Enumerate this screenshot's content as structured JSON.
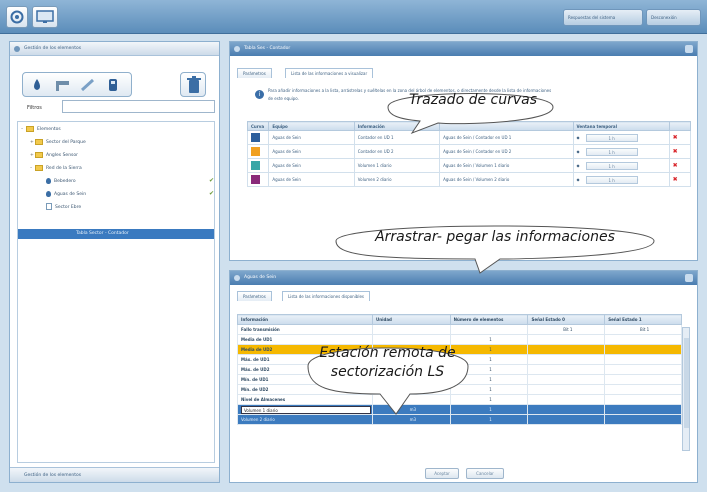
{
  "topbar": {
    "right_buttons": [
      "Respuestas del sistema",
      "Desconexión"
    ]
  },
  "left_panel": {
    "header": "Gestión de los elementos",
    "filter_label": "Filtros",
    "filter_value": "",
    "tree": [
      {
        "label": "Elementos",
        "kind": "folder",
        "level": 0,
        "expanded": true
      },
      {
        "label": "Sector del Parque",
        "kind": "folder",
        "level": 1,
        "expanded": false
      },
      {
        "label": "Angles Sensor",
        "kind": "folder",
        "level": 1,
        "expanded": false
      },
      {
        "label": "Red de la Sierra",
        "kind": "folder",
        "level": 1,
        "expanded": true
      },
      {
        "label": "Bebedero",
        "kind": "drop",
        "level": 2,
        "checked": true
      },
      {
        "label": "Aguas de Sein",
        "kind": "drop",
        "level": 2,
        "checked": true
      },
      {
        "label": "Sector Ebre",
        "kind": "page",
        "level": 2,
        "checked": false
      }
    ],
    "selected_item": "Tabla Sector - Contador",
    "footer": "Gestión de los elementos"
  },
  "top_right_panel": {
    "header": "Tabla Ses - Contador",
    "tabs": [
      "Parámetros",
      "Lista de las informaciones a visualizar"
    ],
    "info_lines": [
      "Para añadir informaciones a la lista, arrástrelas y suéltelas en la zona del árbol de elementos, o directamente desde la lista de informaciones",
      "de este equipo."
    ],
    "columns": [
      "Curva",
      "Equipo",
      "Información",
      "",
      "Ventana temporal",
      ""
    ],
    "rows": [
      {
        "color": "#2b5e9c",
        "equipo": "Aguas de Sein",
        "info": "Contador en UD 1",
        "full": "Aguas de Sein / Contador en UD 1",
        "window": "1 h"
      },
      {
        "color": "#f0a020",
        "equipo": "Aguas de Sein",
        "info": "Contador en UD 2",
        "full": "Aguas de Sein / Contador en UD 2",
        "window": "1 h"
      },
      {
        "color": "#3aa6a6",
        "equipo": "Aguas de Sein",
        "info": "Volumen 1 diario",
        "full": "Aguas de Sein / Volumen 1 diario",
        "window": "1 h"
      },
      {
        "color": "#8a2a7a",
        "equipo": "Aguas de Sein",
        "info": "Volumen 2 diario",
        "full": "Aguas de Sein / Volumen 2 diario",
        "window": "1 h"
      }
    ]
  },
  "bottom_right_panel": {
    "header": "Aguas de Sein",
    "tabs": [
      "Parámetros",
      "Lista de las informaciones disponibles"
    ],
    "columns": [
      "Información",
      "Unidad",
      "Número de elementos",
      "Señal Estado 0",
      "Señal Estado 1"
    ],
    "rows": [
      {
        "name": "Fallo transmisión",
        "unit": "",
        "count": "",
        "s0": "Bit 1",
        "s1": "Bit 1",
        "style": "normal"
      },
      {
        "name": "Media de UD1",
        "unit": "",
        "count": "1",
        "s0": "",
        "s1": "",
        "style": "normal"
      },
      {
        "name": "Media de UD2",
        "unit": "",
        "count": "1",
        "s0": "",
        "s1": "",
        "style": "highlight"
      },
      {
        "name": "Máx. de UD1",
        "unit": "",
        "count": "1",
        "s0": "",
        "s1": "",
        "style": "normal"
      },
      {
        "name": "Máx. de UD2",
        "unit": "",
        "count": "1",
        "s0": "",
        "s1": "",
        "style": "normal"
      },
      {
        "name": "Mín. de UD1",
        "unit": "",
        "count": "1",
        "s0": "",
        "s1": "",
        "style": "normal"
      },
      {
        "name": "Mín. de UD2",
        "unit": "",
        "count": "1",
        "s0": "",
        "s1": "",
        "style": "normal"
      },
      {
        "name": "Nivel de Almacenes",
        "unit": "",
        "count": "1",
        "s0": "",
        "s1": "",
        "style": "normal"
      },
      {
        "name": "Volumen 1 diario",
        "unit": "m3",
        "count": "1",
        "s0": "",
        "s1": "",
        "style": "selected-edit"
      },
      {
        "name": "Volumen 2 diario",
        "unit": "m3",
        "count": "1",
        "s0": "",
        "s1": "",
        "style": "selected"
      }
    ],
    "buttons": [
      "Aceptar",
      "Cancelar"
    ]
  },
  "callouts": {
    "top": "Trazado de curvas",
    "middle": "Arrastrar- pegar las informaciones",
    "bottom_line1": "Estación remota de",
    "bottom_line2": "sectorización LS"
  }
}
